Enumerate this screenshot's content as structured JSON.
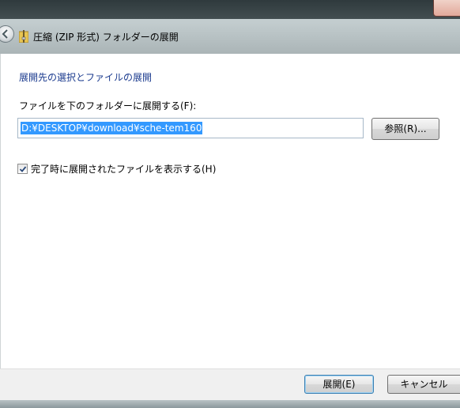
{
  "window": {
    "title": "圧縮 (ZIP 形式) フォルダーの展開"
  },
  "main": {
    "heading": "展開先の選択とファイルの展開",
    "destination_label": "ファイルを下のフォルダーに展開する(F):",
    "destination_value": "D:¥DESKTOP¥download¥sche-tem160",
    "browse_label": "参照(R)...",
    "show_files_label": "完了時に展開されたファイルを表示する(H)",
    "show_files_checked": true
  },
  "footer": {
    "extract_label": "展開(E)",
    "cancel_label": "キャンセル"
  },
  "icons": {
    "back": "back-arrow-icon",
    "app": "zip-folder-icon",
    "check": "checkmark-icon"
  },
  "colors": {
    "heading": "#1a3a8e",
    "selection": "#3399ff",
    "default_button_border": "#3c7fb1"
  }
}
